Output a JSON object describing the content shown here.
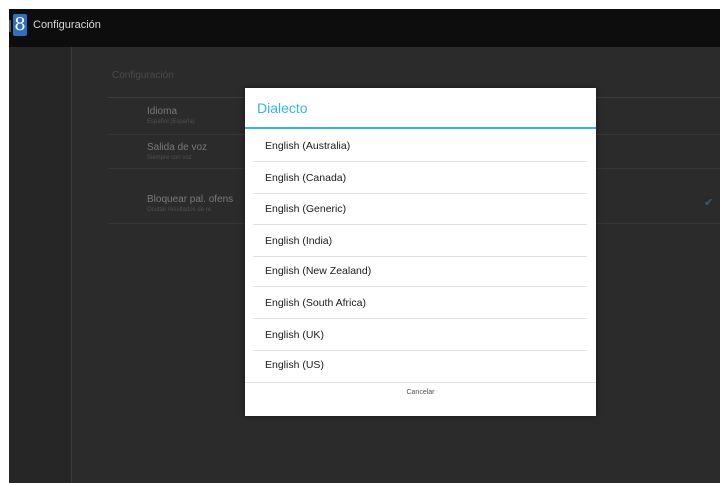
{
  "actionbar": {
    "app_icon_glyph": "8",
    "title": "Configuración"
  },
  "settings": {
    "section_header": "Configuración",
    "items": [
      {
        "title": "Idioma",
        "summary": "Español (España)"
      },
      {
        "title": "Salida de voz",
        "summary": "Siempre con voz"
      },
      {
        "title": "Bloquear pal. ofens",
        "summary": "Ocultar resultados de re"
      }
    ],
    "checkbox_checked": true
  },
  "dialog": {
    "title": "Dialecto",
    "options": [
      "English (Australia)",
      "English (Canada)",
      "English (Generic)",
      "English (India)",
      "English (New Zealand)",
      "English (South Africa)",
      "English (UK)",
      "English (US)"
    ],
    "cancel_label": "Cancelar"
  },
  "colors": {
    "accent": "#33b5e5",
    "overlay_bg": "#2a2a2a",
    "dialog_bg": "#ffffff"
  }
}
